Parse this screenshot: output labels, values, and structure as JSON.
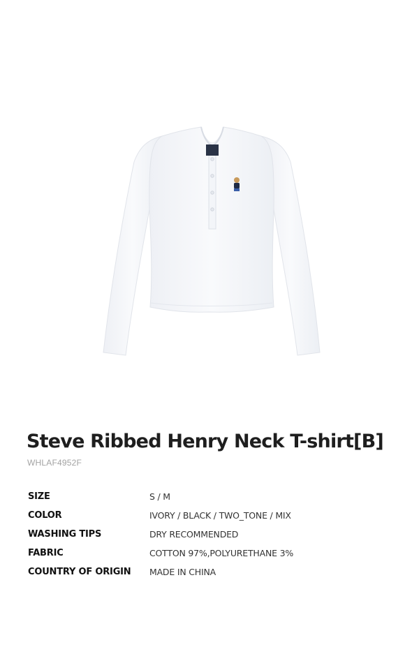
{
  "product": {
    "image_alt": "white long-sleeve ribbed henley t-shirt with embroidered bear logo",
    "title": "Steve Ribbed Henry Neck T-shirt[B]",
    "code": "WHLAF4952F"
  },
  "specs": [
    {
      "label": "SIZE",
      "value": "S / M"
    },
    {
      "label": "COLOR",
      "value": "IVORY / BLACK / TWO_TONE / MIX"
    },
    {
      "label": "WASHING TIPS",
      "value": "DRY RECOMMENDED"
    },
    {
      "label": "FABRIC",
      "value": "COTTON 97%,POLYURETHANE 3%"
    },
    {
      "label": "COUNTRY OF ORIGIN",
      "value": "MADE IN CHINA"
    }
  ],
  "colors": {
    "shirt": "#f7f8fb",
    "shirt_shadow": "#e3e6ec",
    "label_tag": "#2a3346",
    "bear_body": "#1f2a44",
    "bear_head": "#c89a5c"
  }
}
